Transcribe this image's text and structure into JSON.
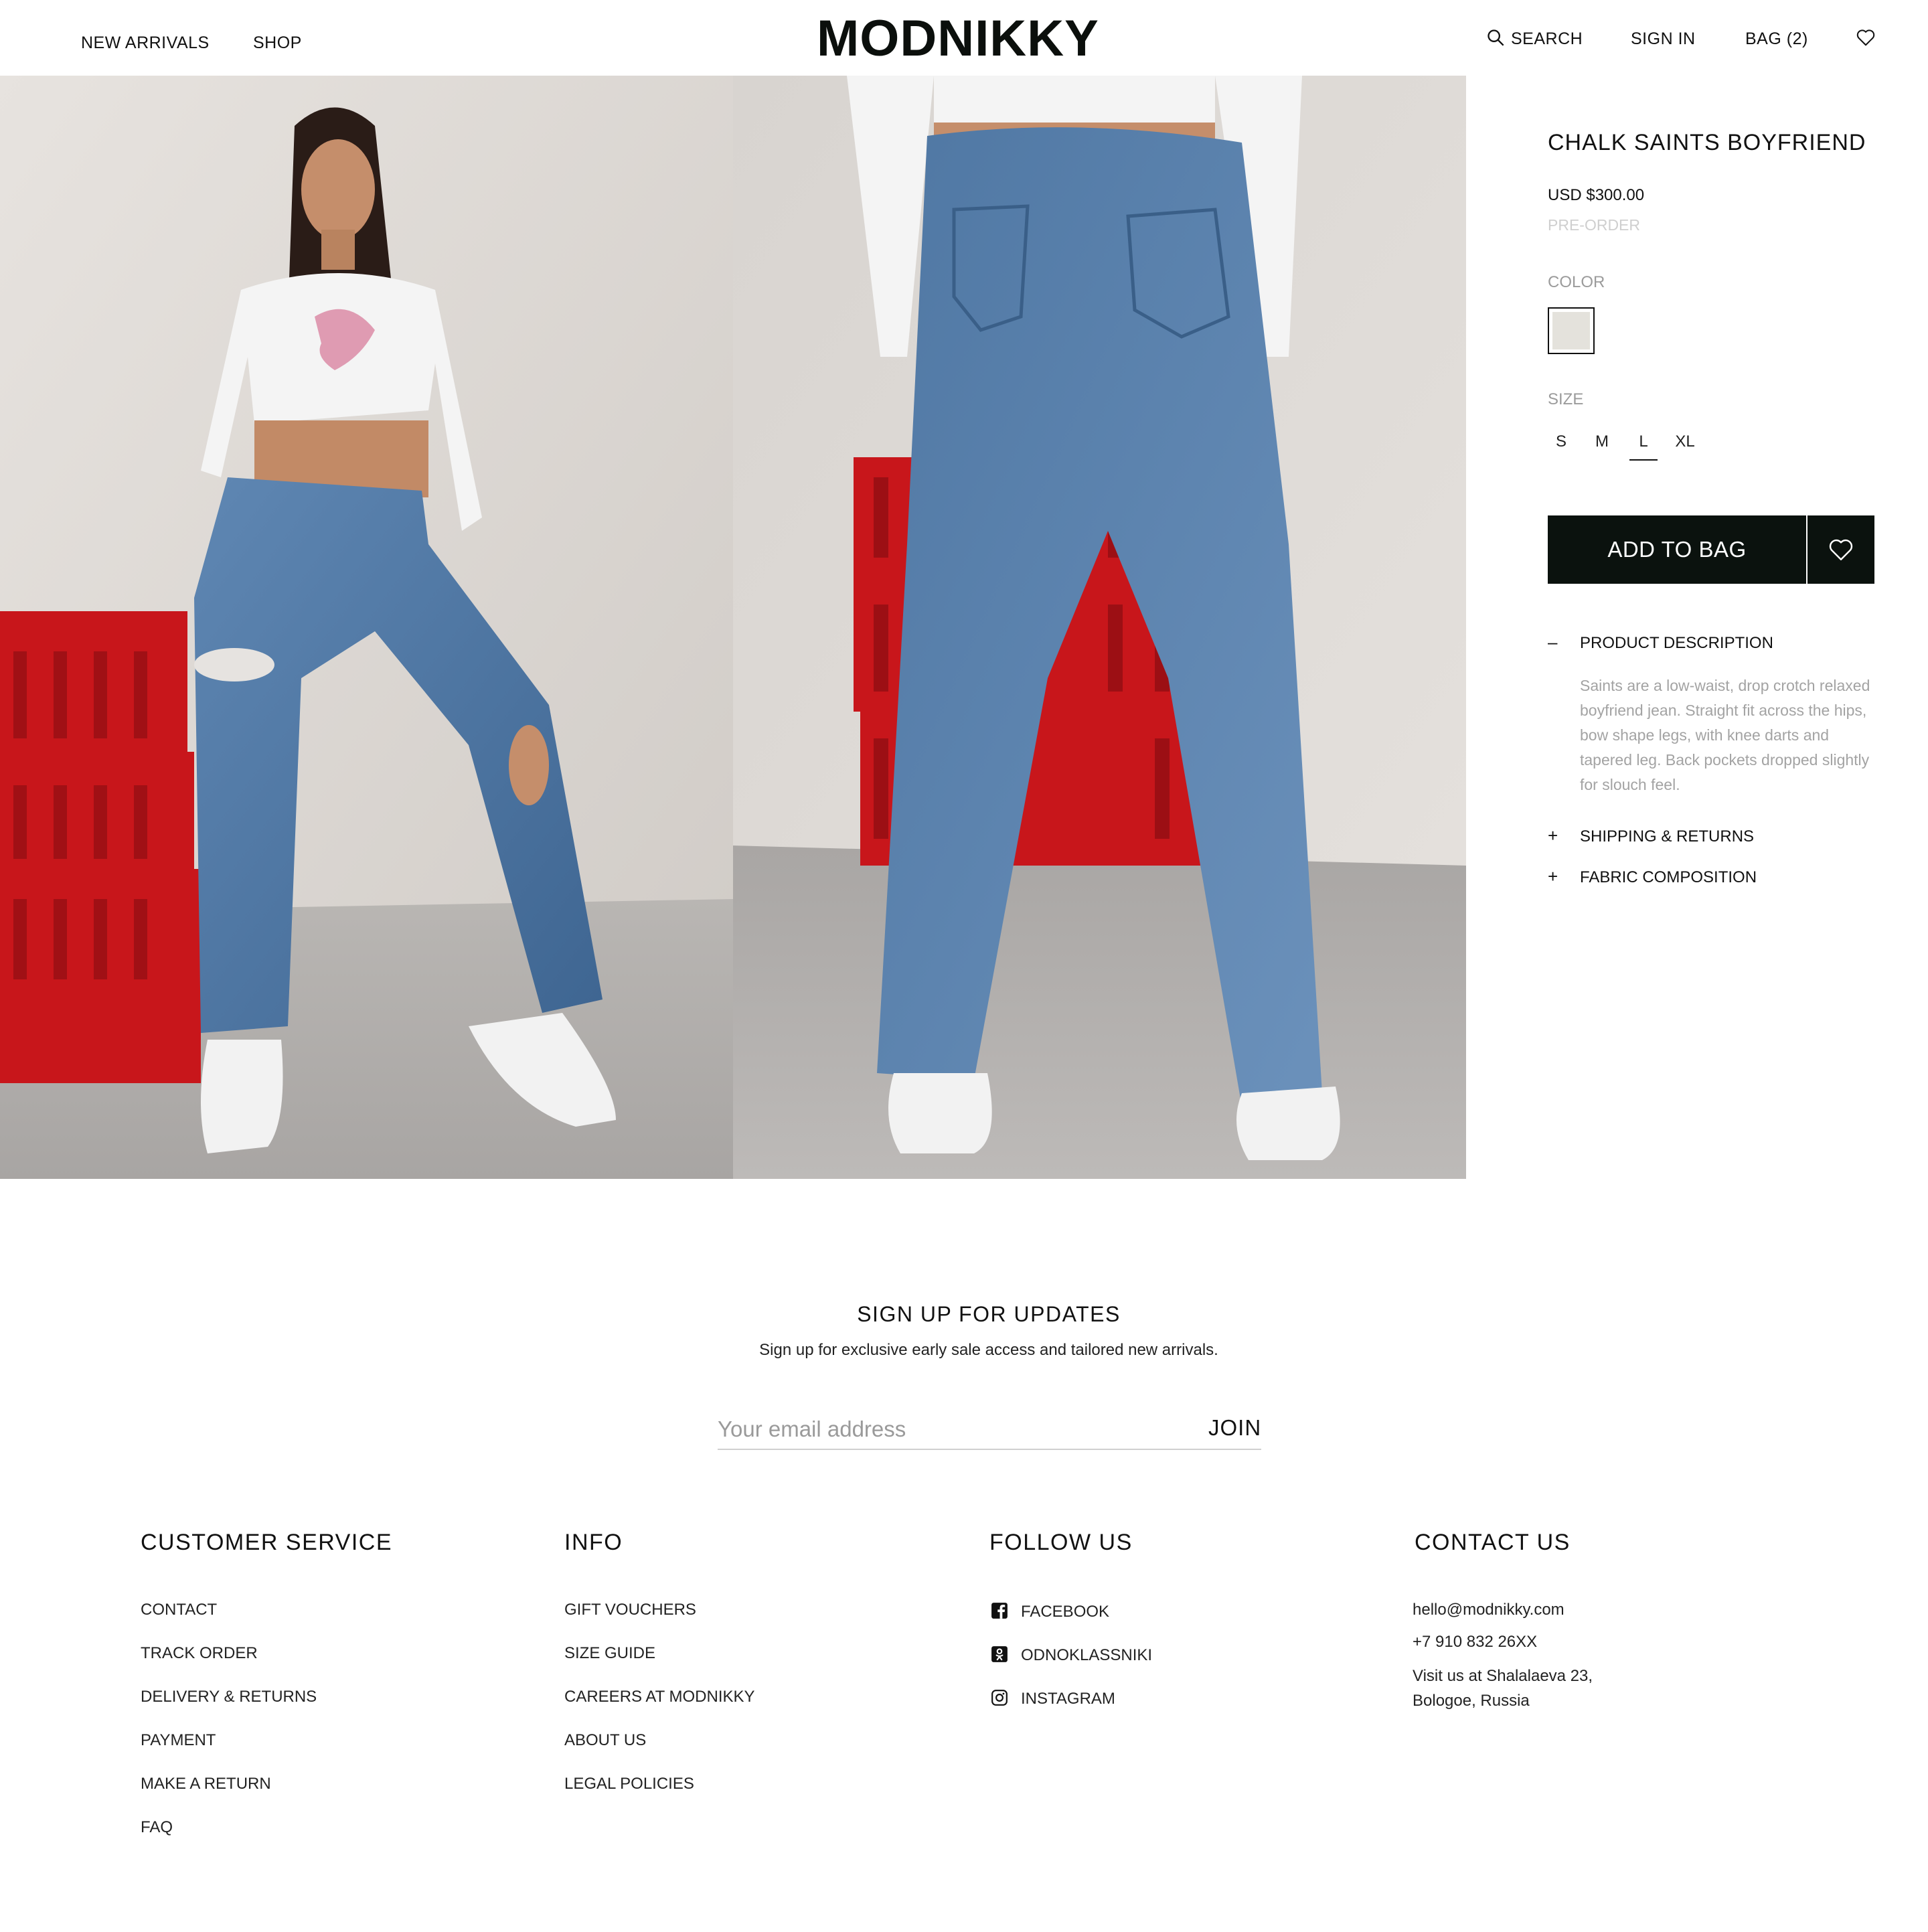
{
  "header": {
    "nav": [
      "NEW ARRIVALS",
      "SHOP"
    ],
    "logo": "MODNIKKY",
    "search_label": "SEARCH",
    "signin_label": "SIGN IN",
    "bag_label": "BAG (2)"
  },
  "product": {
    "title": "CHALK SAINTS BOYFRIEND",
    "price": "USD $300.00",
    "preorder": "PRE-ORDER",
    "color_label": "COLOR",
    "swatch_color": "#e4e2dc",
    "size_label": "SIZE",
    "sizes": [
      "S",
      "M",
      "L",
      "XL"
    ],
    "selected_size": "L",
    "add_to_bag": "ADD TO BAG",
    "accordion": [
      {
        "sign": "–",
        "title": "PRODUCT DESCRIPTION",
        "expanded": true
      },
      {
        "sign": "+",
        "title": "SHIPPING & RETURNS",
        "expanded": false
      },
      {
        "sign": "+",
        "title": "FABRIC COMPOSITION",
        "expanded": false
      }
    ],
    "description": "Saints are a low-waist, drop crotch relaxed boyfriend jean. Straight fit across the hips, bow shape legs, with knee darts and tapered leg. Back pockets dropped slightly for slouch feel."
  },
  "newsletter": {
    "title": "SIGN UP FOR UPDATES",
    "subtitle": "Sign up for exclusive early sale access and tailored new arrivals.",
    "placeholder": "Your email address",
    "join": "JOIN"
  },
  "footer": {
    "customer_service": {
      "title": "CUSTOMER SERVICE",
      "links": [
        "CONTACT",
        "TRACK ORDER",
        "DELIVERY & RETURNS",
        "PAYMENT",
        "MAKE A RETURN",
        "FAQ"
      ]
    },
    "info": {
      "title": "INFO",
      "links": [
        "GIFT VOUCHERS",
        "SIZE GUIDE",
        "CAREERS AT MODNIKKY",
        "ABOUT US",
        "LEGAL POLICIES"
      ]
    },
    "follow": {
      "title": "FOLLOW US",
      "links": [
        {
          "label": "FACEBOOK",
          "icon": "facebook-icon"
        },
        {
          "label": "ODNOKLASSNIKI",
          "icon": "odnoklassniki-icon"
        },
        {
          "label": "INSTAGRAM",
          "icon": "instagram-icon"
        }
      ]
    },
    "contact": {
      "title": "CONTACT US",
      "email": "hello@modnikky.com",
      "phone": "+7 910 832 26XX",
      "address_line1": "Visit us at Shalalaeva 23,",
      "address_line2": "Bologoe, Russia"
    }
  },
  "colors": {
    "button_bg": "#0b120e",
    "muted_text": "#a3a3a3",
    "preorder_text": "#cfcfcf"
  }
}
